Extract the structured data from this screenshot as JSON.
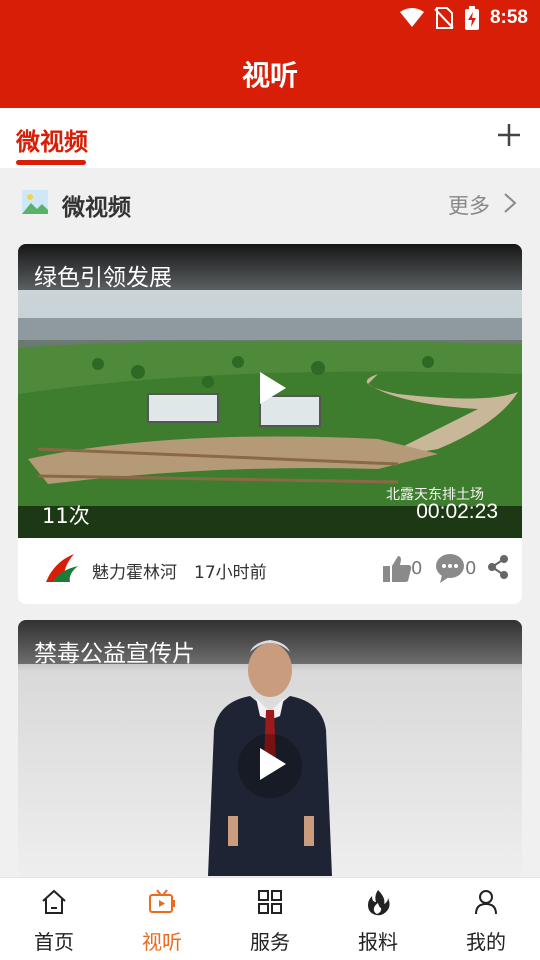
{
  "status": {
    "time": "8:58"
  },
  "header": {
    "title": "视听"
  },
  "tabs": {
    "active": "微视频"
  },
  "section": {
    "title": "微视频",
    "more": "更多"
  },
  "cards": [
    {
      "title": "绿色引领发展",
      "views": "11次",
      "duration": "00:02:23",
      "watermark": "北露天东排土场",
      "source": "魅力霍林河",
      "time_ago": "17小时前",
      "likes": "0",
      "comments": "0"
    },
    {
      "title": "禁毒公益宣传片"
    }
  ],
  "nav": [
    {
      "label": "首页",
      "icon": "home-icon"
    },
    {
      "label": "视听",
      "icon": "tv-icon",
      "active": true
    },
    {
      "label": "服务",
      "icon": "grid-icon"
    },
    {
      "label": "报料",
      "icon": "flame-icon"
    },
    {
      "label": "我的",
      "icon": "user-icon"
    }
  ],
  "colors": {
    "brand": "#d81e06",
    "nav_active": "#ee6a1f"
  }
}
